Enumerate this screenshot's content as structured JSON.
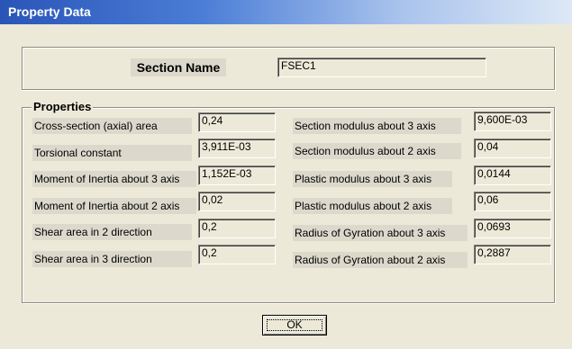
{
  "window": {
    "title": "Property Data"
  },
  "section": {
    "label": "Section Name",
    "value": "FSEC1"
  },
  "properties": {
    "title": "Properties",
    "left": [
      {
        "label": "Cross-section (axial) area",
        "value": "0,24"
      },
      {
        "label": "Torsional constant",
        "value": "3,911E-03"
      },
      {
        "label": "Moment of Inertia about 3 axis",
        "value": "1,152E-03"
      },
      {
        "label": "Moment of Inertia about 2 axis",
        "value": "0,02"
      },
      {
        "label": "Shear area in 2 direction",
        "value": "0,2"
      },
      {
        "label": "Shear area in 3 direction",
        "value": "0,2"
      }
    ],
    "right": [
      {
        "label": "Section modulus about 3 axis",
        "value": "9,600E-03"
      },
      {
        "label": "Section modulus about 2 axis",
        "value": "0,04"
      },
      {
        "label": "Plastic modulus about 3 axis",
        "value": "0,0144"
      },
      {
        "label": "Plastic modulus about 2 axis",
        "value": "0,06"
      },
      {
        "label": "Radius of Gyration about 3 axis",
        "value": "0,0693"
      },
      {
        "label": "Radius of Gyration about 2 axis",
        "value": "0,2887"
      }
    ]
  },
  "buttons": {
    "ok_label": "OK"
  }
}
